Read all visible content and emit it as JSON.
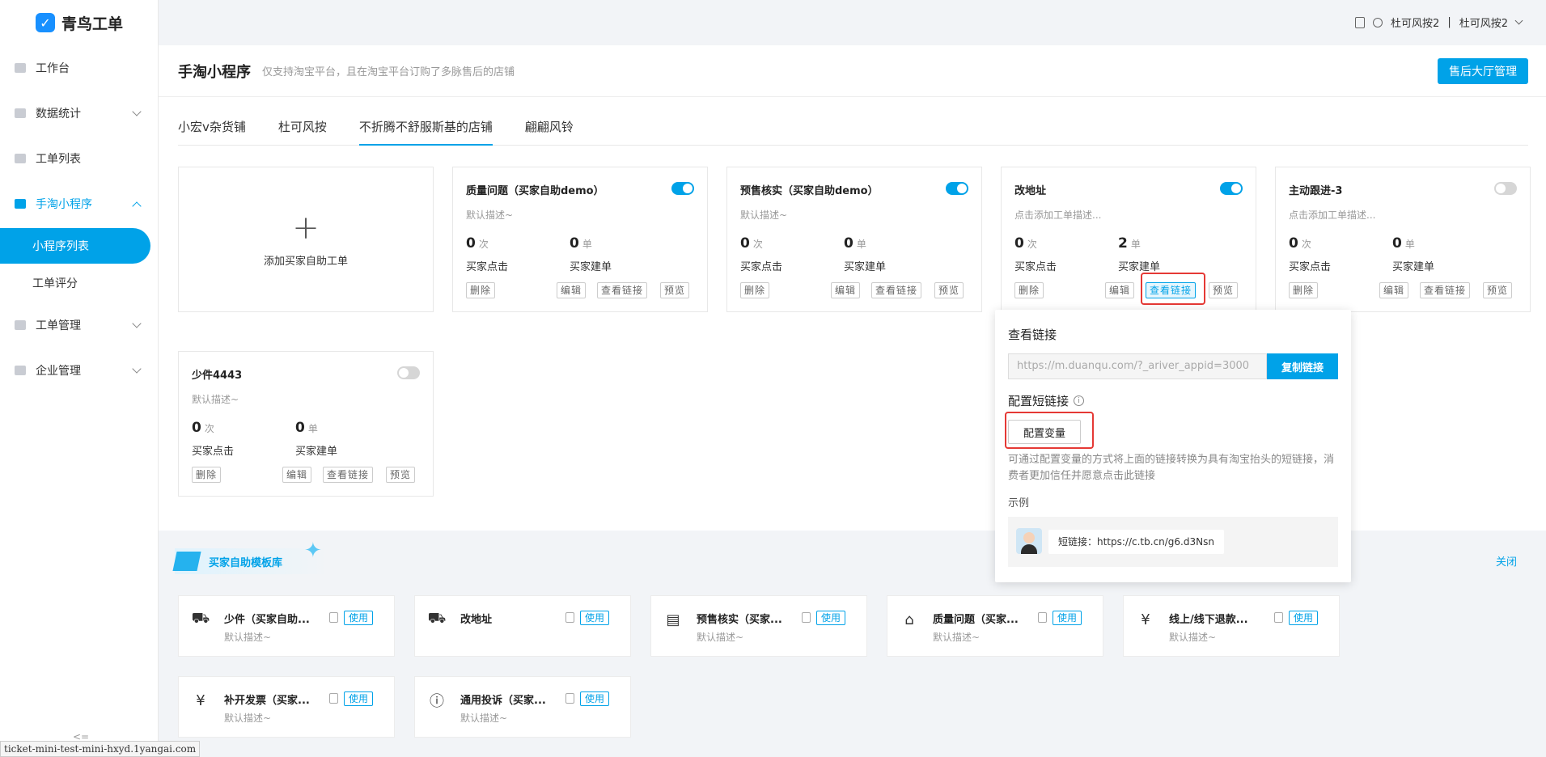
{
  "app": {
    "logo_text": "青鸟工单"
  },
  "sidebar": {
    "items": [
      {
        "label": "工作台"
      },
      {
        "label": "数据统计"
      },
      {
        "label": "工单列表"
      },
      {
        "label": "手淘小程序"
      },
      {
        "label": "小程序列表"
      },
      {
        "label": "工单评分"
      },
      {
        "label": "工单管理"
      },
      {
        "label": "企业管理"
      }
    ],
    "collapse": "<="
  },
  "status_url": "ticket-mini-test-mini-hxyd.1yangai.com",
  "header": {
    "user": "杜可风按2",
    "separator": "|",
    "account": "杜可风按2"
  },
  "page": {
    "title": "手淘小程序",
    "subtitle": "仅支持淘宝平台，且在淘宝平台订购了多脉售后的店铺",
    "head_button": "售后大厅管理",
    "tabs": [
      "小宏v杂货铺",
      "杜可风按",
      "不折腾不舒服斯基的店铺",
      "翩翩风铃"
    ],
    "active_tab": "不折腾不舒服斯基的店铺"
  },
  "add_card": {
    "plus": "+",
    "label": "添加买家自助工单"
  },
  "cards": [
    {
      "title": "质量问题（买家自助demo）",
      "enabled": true,
      "desc": "默认描述~",
      "clicks": "0",
      "clicks_unit": "次",
      "clicks_label": "买家点击",
      "orders": "0",
      "orders_unit": "单",
      "orders_label": "买家建单",
      "delete": "删除",
      "edit": "编辑",
      "link": "查看链接",
      "preview": "预览"
    },
    {
      "title": "预售核实（买家自助demo）",
      "enabled": true,
      "desc": "默认描述~",
      "clicks": "0",
      "clicks_unit": "次",
      "clicks_label": "买家点击",
      "orders": "0",
      "orders_unit": "单",
      "orders_label": "买家建单",
      "delete": "删除",
      "edit": "编辑",
      "link": "查看链接",
      "preview": "预览"
    },
    {
      "title": "改地址",
      "enabled": true,
      "desc": "点击添加工单描述...",
      "clicks": "0",
      "clicks_unit": "次",
      "clicks_label": "买家点击",
      "orders": "2",
      "orders_unit": "单",
      "orders_label": "买家建单",
      "delete": "删除",
      "edit": "编辑",
      "link": "查看链接",
      "preview": "预览"
    },
    {
      "title": "主动跟进-3",
      "enabled": false,
      "desc": "点击添加工单描述...",
      "clicks": "0",
      "clicks_unit": "次",
      "clicks_label": "买家点击",
      "orders": "0",
      "orders_unit": "单",
      "orders_label": "买家建单",
      "delete": "删除",
      "edit": "编辑",
      "link": "查看链接",
      "preview": "预览"
    },
    {
      "title": "少件4443",
      "enabled": false,
      "desc": "默认描述~",
      "clicks": "0",
      "clicks_unit": "次",
      "clicks_label": "买家点击",
      "orders": "0",
      "orders_unit": "单",
      "orders_label": "买家建单",
      "delete": "删除",
      "edit": "编辑",
      "link": "查看链接",
      "preview": "预览"
    }
  ],
  "popup": {
    "title": "查看链接",
    "url": "https://m.duanqu.com/?_ariver_appid=3000",
    "copy": "复制链接",
    "subtitle": "配置短链接",
    "info": "i",
    "config_button": "配置变量",
    "note": "可通过配置变量的方式将上面的链接转换为具有淘宝抬头的短链接，消费者更加信任并愿意点击此链接",
    "example_label": "示例",
    "example_link": "短链接：https://c.tb.cn/g6.d3Nsn"
  },
  "templates": {
    "banner": "买家自助模板库",
    "close": "关闭",
    "use_label": "使用",
    "items": [
      {
        "icon": "truck-icon",
        "name": "少件（买家自助...",
        "desc": "默认描述~"
      },
      {
        "icon": "truck-icon",
        "name": "改地址",
        "desc": ""
      },
      {
        "icon": "bag-icon",
        "name": "预售核实（买家...",
        "desc": "默认描述~"
      },
      {
        "icon": "home-icon",
        "name": "质量问题（买家...",
        "desc": "默认描述~"
      },
      {
        "icon": "yen-circle-icon",
        "name": "线上/线下退款...",
        "desc": "默认描述~"
      },
      {
        "icon": "receipt-icon",
        "name": "补开发票（买家...",
        "desc": "默认描述~"
      },
      {
        "icon": "info-circle-icon",
        "name": "通用投诉（买家...",
        "desc": "默认描述~"
      }
    ]
  },
  "colors": {
    "accent": "#00a2e8",
    "highlight": "#e53935"
  }
}
